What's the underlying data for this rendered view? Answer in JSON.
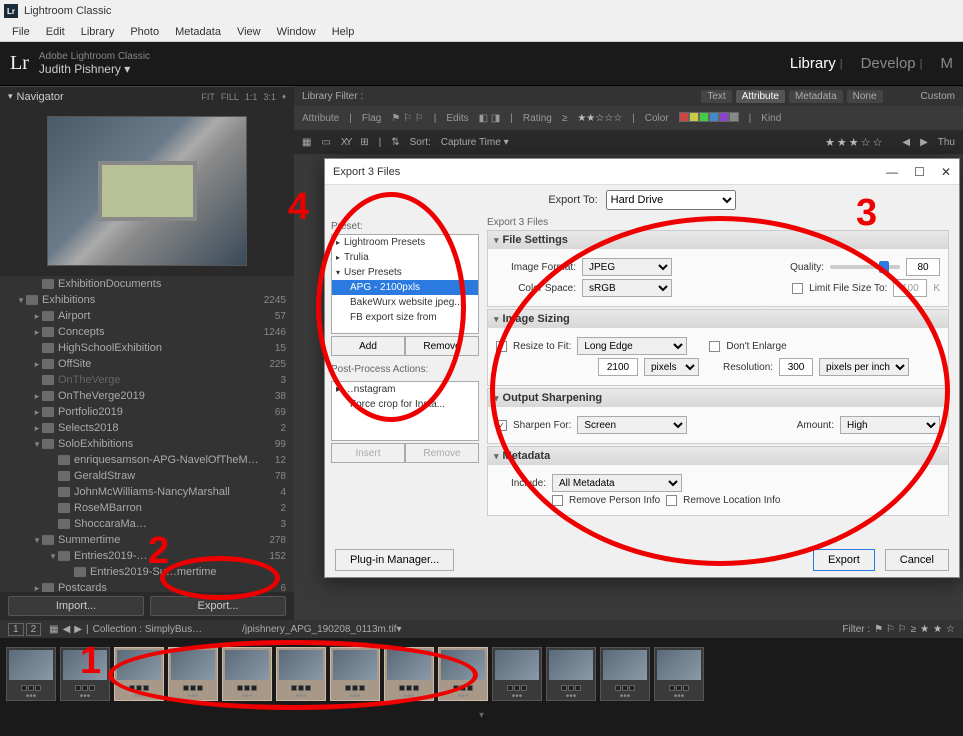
{
  "window": {
    "title": "Lightroom Classic",
    "logo": "Lr"
  },
  "menubar": [
    "File",
    "Edit",
    "Library",
    "Photo",
    "Metadata",
    "View",
    "Window",
    "Help"
  ],
  "brand": {
    "product": "Adobe Lightroom Classic",
    "user": "Judith Pishnery",
    "modules": [
      "Library",
      "Develop",
      "M"
    ]
  },
  "libfilter": {
    "label": "Library Filter :",
    "tabs": [
      "Text",
      "Attribute",
      "Metadata",
      "None"
    ],
    "selected": "Attribute",
    "custom": "Custom",
    "attr": {
      "attribute": "Attribute",
      "flag": "Flag",
      "edits": "Edits",
      "rating": "Rating",
      "ge": "≥",
      "color": "Color",
      "kind": "Kind"
    }
  },
  "navigator": {
    "title": "Navigator",
    "opts": [
      "FIT",
      "FILL",
      "1:1",
      "3:1"
    ]
  },
  "folders": [
    {
      "d": 2,
      "tri": "",
      "name": "ExhibitionDocuments",
      "cnt": ""
    },
    {
      "d": 1,
      "tri": "▾",
      "name": "Exhibitions",
      "cnt": "2245"
    },
    {
      "d": 2,
      "tri": "▸",
      "name": "Airport",
      "cnt": "57"
    },
    {
      "d": 2,
      "tri": "▸",
      "name": "Concepts",
      "cnt": "1246"
    },
    {
      "d": 2,
      "tri": "",
      "name": "HighSchoolExhibition",
      "cnt": "15"
    },
    {
      "d": 2,
      "tri": "▸",
      "name": "OffSite",
      "cnt": "225"
    },
    {
      "d": 2,
      "tri": "",
      "name": "OnTheVerge",
      "cnt": "3",
      "dim": true
    },
    {
      "d": 2,
      "tri": "▸",
      "name": "OnTheVerge2019",
      "cnt": "38"
    },
    {
      "d": 2,
      "tri": "▸",
      "name": "Portfolio2019",
      "cnt": "69"
    },
    {
      "d": 2,
      "tri": "▸",
      "name": "Selects2018",
      "cnt": "2"
    },
    {
      "d": 2,
      "tri": "▾",
      "name": "SoloExhibitions",
      "cnt": "99"
    },
    {
      "d": 3,
      "tri": "",
      "name": "enriquesamson-APG-NavelOfTheM…",
      "cnt": "12"
    },
    {
      "d": 3,
      "tri": "",
      "name": "GeraldStraw",
      "cnt": "78"
    },
    {
      "d": 3,
      "tri": "",
      "name": "JohnMcWilliams-NancyMarshall",
      "cnt": "4"
    },
    {
      "d": 3,
      "tri": "",
      "name": "RoseMBarron",
      "cnt": "2"
    },
    {
      "d": 3,
      "tri": "",
      "name": "ShoccaraMa…",
      "cnt": "3"
    },
    {
      "d": 2,
      "tri": "▾",
      "name": "Summertime",
      "cnt": "278"
    },
    {
      "d": 3,
      "tri": "▾",
      "name": "Entries2019-…",
      "cnt": "152"
    },
    {
      "d": 4,
      "tri": "",
      "name": "Entries2019-Su…mertime",
      "cnt": ""
    },
    {
      "d": 2,
      "tri": "▸",
      "name": "Postcards",
      "cnt": "6"
    }
  ],
  "leftbtns": {
    "import": "Import...",
    "export": "Export..."
  },
  "dialog": {
    "title": "Export 3 Files",
    "exportto_lbl": "Export To:",
    "exportto_val": "Hard Drive",
    "preset_lbl": "Preset:",
    "presets_groups": [
      {
        "type": "hdr",
        "open": false,
        "label": "Lightroom Presets"
      },
      {
        "type": "hdr",
        "open": false,
        "label": "Trulia"
      },
      {
        "type": "hdr",
        "open": true,
        "label": "User Presets"
      },
      {
        "type": "item",
        "sel": true,
        "label": "APG - 2100pxls"
      },
      {
        "type": "item",
        "label": "BakeWurx website jpeg..."
      },
      {
        "type": "item",
        "label": "FB export size from"
      }
    ],
    "add": "Add",
    "remove": "Remove",
    "ppa_lbl": "Post-Process Actions:",
    "ppa": [
      {
        "type": "hdr",
        "label": "…nstagram"
      },
      {
        "type": "item",
        "label": "Force crop for Insta..."
      }
    ],
    "insert": "Insert",
    "remove2": "Remove",
    "sub": "Export 3 Files",
    "file_settings": {
      "title": "File Settings",
      "format_lbl": "Image Format:",
      "format_val": "JPEG",
      "quality_lbl": "Quality:",
      "quality_val": "80",
      "color_lbl": "Color Space:",
      "color_val": "sRGB",
      "limit_lbl": "Limit File Size To:",
      "limit_val": "100",
      "limit_unit": "K"
    },
    "sizing": {
      "title": "Image Sizing",
      "resize_lbl": "Resize to Fit:",
      "resize_val": "Long Edge",
      "dont_enlarge": "Don't Enlarge",
      "size_val": "2100",
      "size_unit": "pixels",
      "res_lbl": "Resolution:",
      "res_val": "300",
      "res_unit": "pixels per inch"
    },
    "sharpen": {
      "title": "Output Sharpening",
      "for_lbl": "Sharpen For:",
      "for_val": "Screen",
      "amt_lbl": "Amount:",
      "amt_val": "High"
    },
    "metadata": {
      "title": "Metadata",
      "include_lbl": "Include:",
      "include_val": "All Metadata",
      "rperson": "Remove Person Info",
      "rloc": "Remove Location Info"
    },
    "plugin": "Plug-in Manager...",
    "export": "Export",
    "cancel": "Cancel"
  },
  "toolbar": {
    "sort_lbl": "Sort:",
    "sort_val": "Capture Time",
    "thu": "Thu"
  },
  "filmstrip": {
    "collection_lbl": "Collection : SimplyBus…",
    "file": "/jpishnery_APG_190208_0113m.tif",
    "filter_lbl": "Filter :",
    "tabnums": [
      "1",
      "2"
    ]
  },
  "annotations": {
    "a1": "1",
    "a2": "2",
    "a3": "3",
    "a4": "4"
  }
}
